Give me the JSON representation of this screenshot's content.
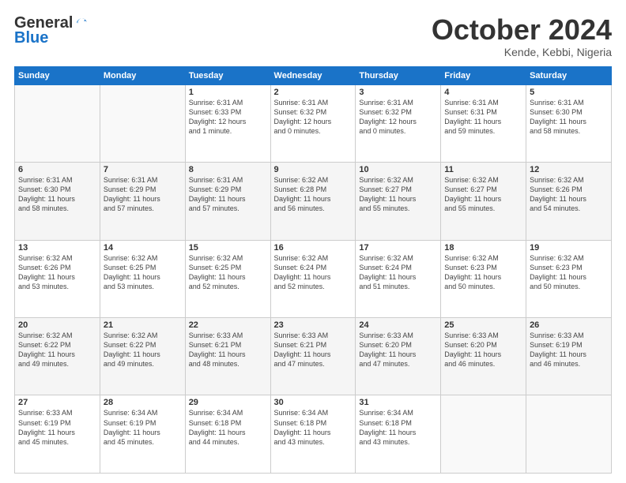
{
  "header": {
    "logo_line1": "General",
    "logo_line2": "Blue",
    "month": "October 2024",
    "location": "Kende, Kebbi, Nigeria"
  },
  "weekdays": [
    "Sunday",
    "Monday",
    "Tuesday",
    "Wednesday",
    "Thursday",
    "Friday",
    "Saturday"
  ],
  "weeks": [
    [
      {
        "day": "",
        "info": ""
      },
      {
        "day": "",
        "info": ""
      },
      {
        "day": "1",
        "info": "Sunrise: 6:31 AM\nSunset: 6:33 PM\nDaylight: 12 hours\nand 1 minute."
      },
      {
        "day": "2",
        "info": "Sunrise: 6:31 AM\nSunset: 6:32 PM\nDaylight: 12 hours\nand 0 minutes."
      },
      {
        "day": "3",
        "info": "Sunrise: 6:31 AM\nSunset: 6:32 PM\nDaylight: 12 hours\nand 0 minutes."
      },
      {
        "day": "4",
        "info": "Sunrise: 6:31 AM\nSunset: 6:31 PM\nDaylight: 11 hours\nand 59 minutes."
      },
      {
        "day": "5",
        "info": "Sunrise: 6:31 AM\nSunset: 6:30 PM\nDaylight: 11 hours\nand 58 minutes."
      }
    ],
    [
      {
        "day": "6",
        "info": "Sunrise: 6:31 AM\nSunset: 6:30 PM\nDaylight: 11 hours\nand 58 minutes."
      },
      {
        "day": "7",
        "info": "Sunrise: 6:31 AM\nSunset: 6:29 PM\nDaylight: 11 hours\nand 57 minutes."
      },
      {
        "day": "8",
        "info": "Sunrise: 6:31 AM\nSunset: 6:29 PM\nDaylight: 11 hours\nand 57 minutes."
      },
      {
        "day": "9",
        "info": "Sunrise: 6:32 AM\nSunset: 6:28 PM\nDaylight: 11 hours\nand 56 minutes."
      },
      {
        "day": "10",
        "info": "Sunrise: 6:32 AM\nSunset: 6:27 PM\nDaylight: 11 hours\nand 55 minutes."
      },
      {
        "day": "11",
        "info": "Sunrise: 6:32 AM\nSunset: 6:27 PM\nDaylight: 11 hours\nand 55 minutes."
      },
      {
        "day": "12",
        "info": "Sunrise: 6:32 AM\nSunset: 6:26 PM\nDaylight: 11 hours\nand 54 minutes."
      }
    ],
    [
      {
        "day": "13",
        "info": "Sunrise: 6:32 AM\nSunset: 6:26 PM\nDaylight: 11 hours\nand 53 minutes."
      },
      {
        "day": "14",
        "info": "Sunrise: 6:32 AM\nSunset: 6:25 PM\nDaylight: 11 hours\nand 53 minutes."
      },
      {
        "day": "15",
        "info": "Sunrise: 6:32 AM\nSunset: 6:25 PM\nDaylight: 11 hours\nand 52 minutes."
      },
      {
        "day": "16",
        "info": "Sunrise: 6:32 AM\nSunset: 6:24 PM\nDaylight: 11 hours\nand 52 minutes."
      },
      {
        "day": "17",
        "info": "Sunrise: 6:32 AM\nSunset: 6:24 PM\nDaylight: 11 hours\nand 51 minutes."
      },
      {
        "day": "18",
        "info": "Sunrise: 6:32 AM\nSunset: 6:23 PM\nDaylight: 11 hours\nand 50 minutes."
      },
      {
        "day": "19",
        "info": "Sunrise: 6:32 AM\nSunset: 6:23 PM\nDaylight: 11 hours\nand 50 minutes."
      }
    ],
    [
      {
        "day": "20",
        "info": "Sunrise: 6:32 AM\nSunset: 6:22 PM\nDaylight: 11 hours\nand 49 minutes."
      },
      {
        "day": "21",
        "info": "Sunrise: 6:32 AM\nSunset: 6:22 PM\nDaylight: 11 hours\nand 49 minutes."
      },
      {
        "day": "22",
        "info": "Sunrise: 6:33 AM\nSunset: 6:21 PM\nDaylight: 11 hours\nand 48 minutes."
      },
      {
        "day": "23",
        "info": "Sunrise: 6:33 AM\nSunset: 6:21 PM\nDaylight: 11 hours\nand 47 minutes."
      },
      {
        "day": "24",
        "info": "Sunrise: 6:33 AM\nSunset: 6:20 PM\nDaylight: 11 hours\nand 47 minutes."
      },
      {
        "day": "25",
        "info": "Sunrise: 6:33 AM\nSunset: 6:20 PM\nDaylight: 11 hours\nand 46 minutes."
      },
      {
        "day": "26",
        "info": "Sunrise: 6:33 AM\nSunset: 6:19 PM\nDaylight: 11 hours\nand 46 minutes."
      }
    ],
    [
      {
        "day": "27",
        "info": "Sunrise: 6:33 AM\nSunset: 6:19 PM\nDaylight: 11 hours\nand 45 minutes."
      },
      {
        "day": "28",
        "info": "Sunrise: 6:34 AM\nSunset: 6:19 PM\nDaylight: 11 hours\nand 45 minutes."
      },
      {
        "day": "29",
        "info": "Sunrise: 6:34 AM\nSunset: 6:18 PM\nDaylight: 11 hours\nand 44 minutes."
      },
      {
        "day": "30",
        "info": "Sunrise: 6:34 AM\nSunset: 6:18 PM\nDaylight: 11 hours\nand 43 minutes."
      },
      {
        "day": "31",
        "info": "Sunrise: 6:34 AM\nSunset: 6:18 PM\nDaylight: 11 hours\nand 43 minutes."
      },
      {
        "day": "",
        "info": ""
      },
      {
        "day": "",
        "info": ""
      }
    ]
  ]
}
